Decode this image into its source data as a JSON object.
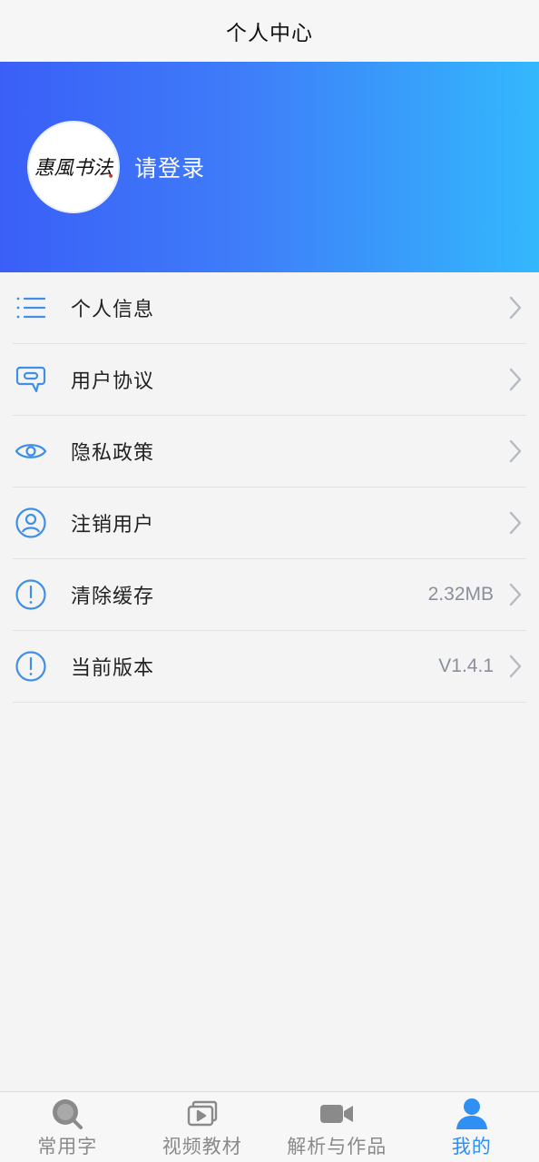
{
  "header": {
    "title": "个人中心"
  },
  "profile": {
    "avatar_text": "惠風书法",
    "login_label": "请登录"
  },
  "menu": {
    "items": [
      {
        "label": "个人信息",
        "value": "",
        "icon": "list-icon"
      },
      {
        "label": "用户协议",
        "value": "",
        "icon": "tag-chat-icon"
      },
      {
        "label": "隐私政策",
        "value": "",
        "icon": "eye-icon"
      },
      {
        "label": "注销用户",
        "value": "",
        "icon": "user-circle-icon"
      },
      {
        "label": "清除缓存",
        "value": "2.32MB",
        "icon": "alert-circle-icon"
      },
      {
        "label": "当前版本",
        "value": "V1.4.1",
        "icon": "alert-circle-icon"
      }
    ]
  },
  "tabbar": {
    "tabs": [
      {
        "label": "常用字",
        "icon": "search-icon",
        "active": false
      },
      {
        "label": "视频教材",
        "icon": "video-play-icon",
        "active": false
      },
      {
        "label": "解析与作品",
        "icon": "camera-icon",
        "active": false
      },
      {
        "label": "我的",
        "icon": "user-icon",
        "active": true
      }
    ]
  },
  "colors": {
    "accent": "#2f8ff2",
    "gradient_start": "#3a5ff7",
    "gradient_end": "#33b8fc",
    "icon_blue": "#3f8fe6",
    "tab_inactive": "#8a8a8a"
  }
}
